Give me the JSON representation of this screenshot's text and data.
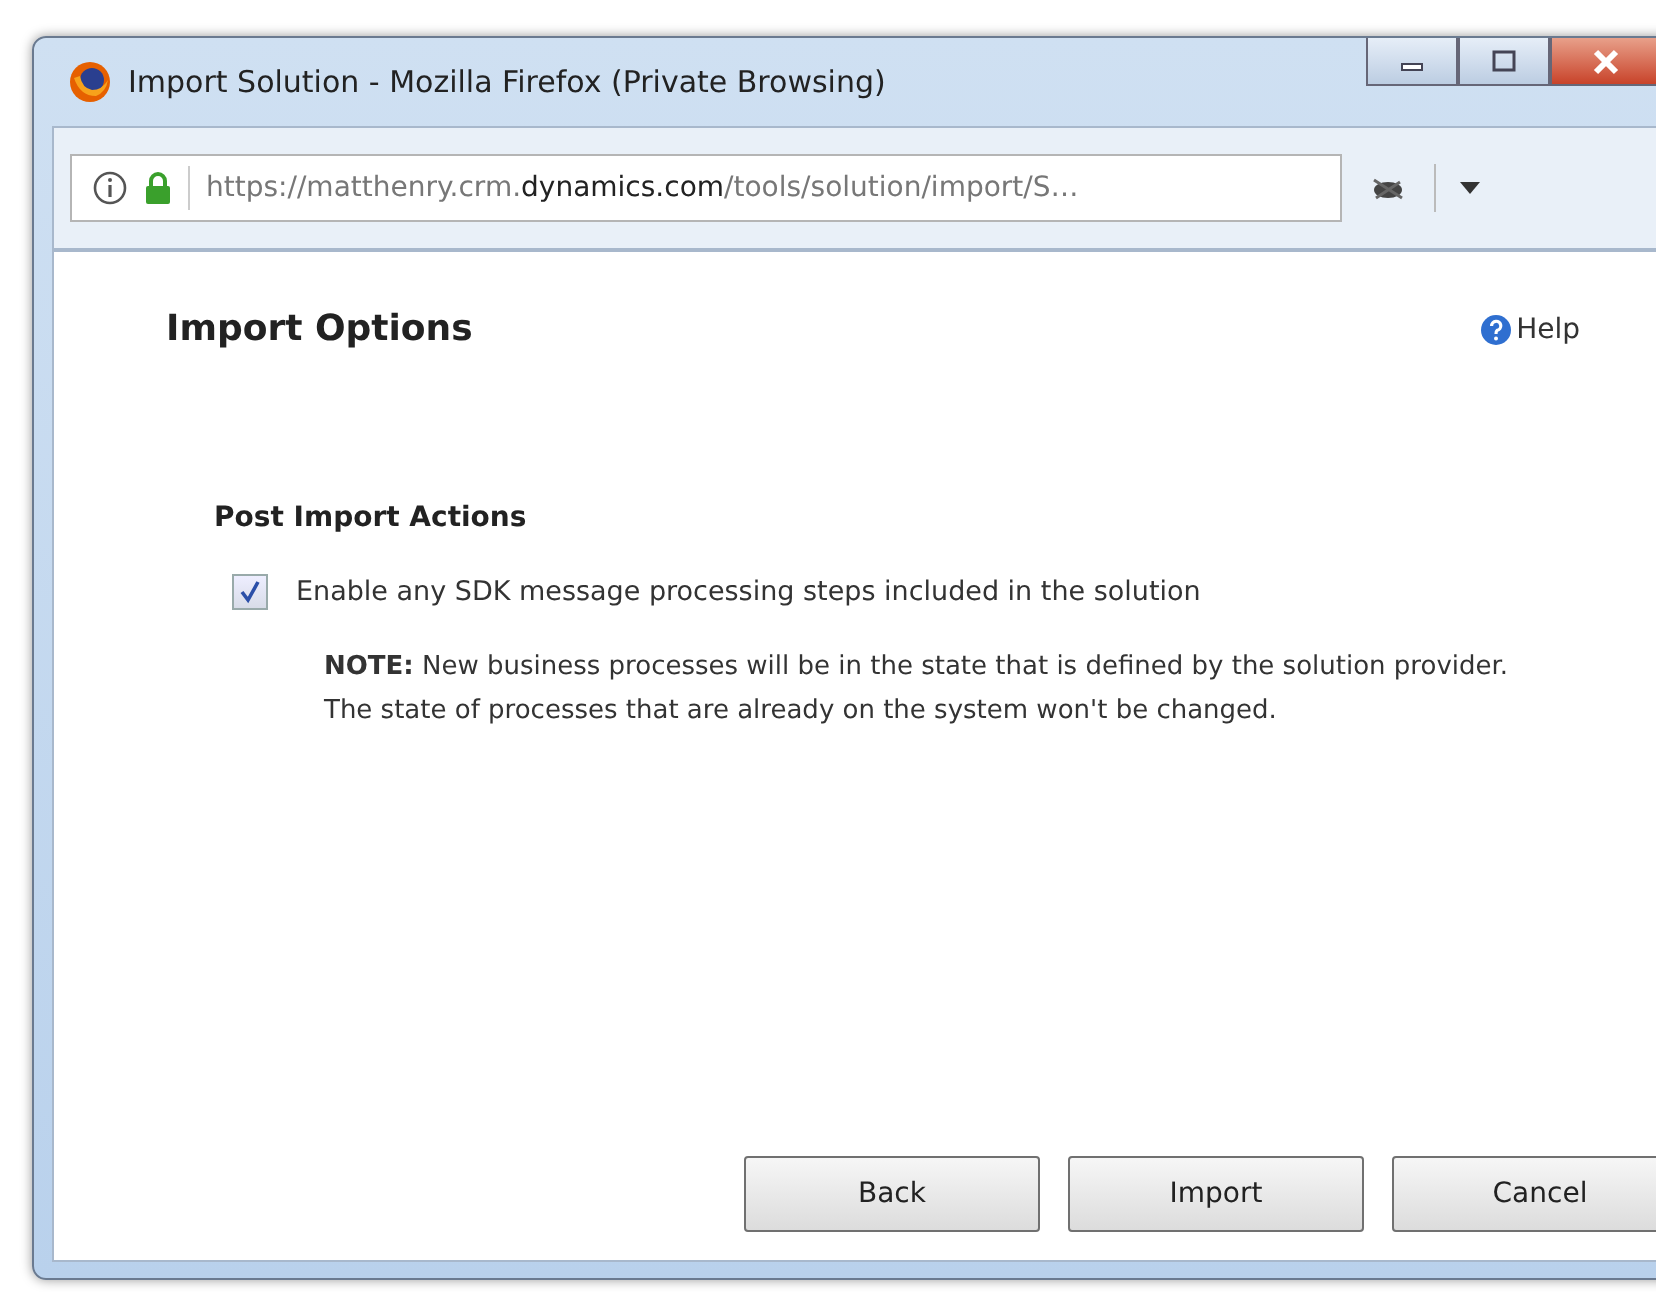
{
  "window": {
    "title": "Import Solution - Mozilla Firefox (Private Browsing)"
  },
  "address_bar": {
    "url_prefix": "https://matthenry.crm.",
    "url_domain": "dynamics.com",
    "url_suffix": "/tools/solution/import/S…"
  },
  "dialog": {
    "title": "Import Options",
    "help": "Help",
    "section": "Post Import Actions",
    "option": {
      "label": "Enable any SDK message processing steps included in the solution",
      "checked": true
    },
    "note": "**NOTE:** New business processes will be in the state that is defined by the solution provider. The state of processes that are already on the system won't be changed.",
    "buttons": [
      "Back",
      "Import",
      "Cancel"
    ]
  }
}
